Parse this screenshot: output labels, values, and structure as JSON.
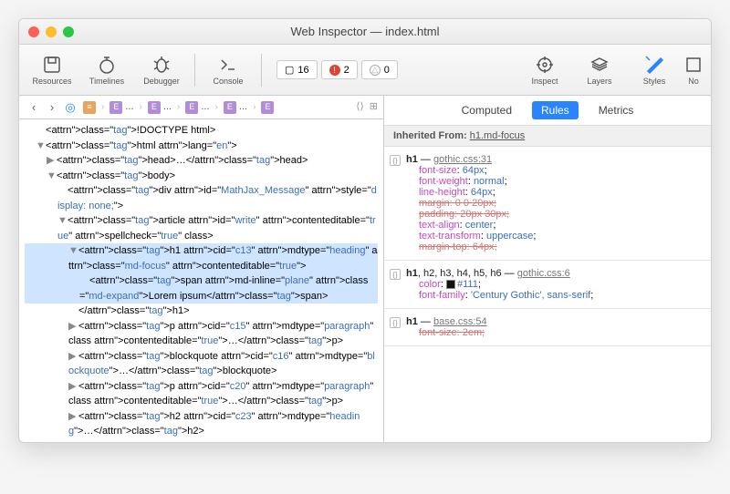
{
  "window": {
    "title": "Web Inspector — index.html"
  },
  "toolbar": {
    "items": [
      {
        "id": "resources",
        "label": "Resources"
      },
      {
        "id": "timelines",
        "label": "Timelines"
      },
      {
        "id": "debugger",
        "label": "Debugger"
      },
      {
        "id": "console",
        "label": "Console"
      },
      {
        "id": "inspect",
        "label": "Inspect"
      },
      {
        "id": "layers",
        "label": "Layers"
      },
      {
        "id": "styles",
        "label": "Styles"
      },
      {
        "id": "node",
        "label": "No"
      }
    ],
    "counters": {
      "resources": "16",
      "errors": "2",
      "warnings": "0"
    }
  },
  "crumbs": {
    "items": [
      "E",
      "...",
      "E",
      "...",
      "E",
      "...",
      "E",
      "...",
      "E"
    ]
  },
  "dom": {
    "lines": [
      {
        "cls": "i1",
        "tri": "",
        "html": "<!DOCTYPE html>"
      },
      {
        "cls": "i1",
        "tri": "▼",
        "html": "<html lang=\"en\">"
      },
      {
        "cls": "i2",
        "tri": "▶",
        "html": "<head>…</head>"
      },
      {
        "cls": "i2",
        "tri": "▼",
        "html": "<body>"
      },
      {
        "cls": "i3",
        "tri": "",
        "html": "<div id=\"MathJax_Message\" style=\"display: none;\">"
      },
      {
        "cls": "i3",
        "tri": "▼",
        "html": "<article id=\"write\" contenteditable=\"true\" spellcheck=\"true\" class>"
      },
      {
        "cls": "i4 hl",
        "tri": "▼",
        "html": "<h1 cid=\"c13\" mdtype=\"heading\" class=\"md-focus\" contenteditable=\"true\">"
      },
      {
        "cls": "i5 hl",
        "tri": "",
        "html": "<span md-inline=\"plane\" class=\"md-expand\">Lorem ipsum</span>"
      },
      {
        "cls": "i4",
        "tri": "",
        "html": "</h1>"
      },
      {
        "cls": "i4",
        "tri": "▶",
        "html": "<p cid=\"c15\" mdtype=\"paragraph\" class contenteditable=\"true\">…</p>"
      },
      {
        "cls": "i4",
        "tri": "▶",
        "html": "<blockquote cid=\"c16\" mdtype=\"blockquote\">…</blockquote>"
      },
      {
        "cls": "i4",
        "tri": "▶",
        "html": "<p cid=\"c20\" mdtype=\"paragraph\" class contenteditable=\"true\">…</p>"
      },
      {
        "cls": "i4",
        "tri": "▶",
        "html": "<h2 cid=\"c23\" mdtype=\"heading\">…</h2>"
      }
    ]
  },
  "styles": {
    "tabs": [
      "Computed",
      "Rules",
      "Metrics"
    ],
    "active_tab": "Rules",
    "inherit_label": "Inherited From:",
    "inherit_selector": "h1.md-focus",
    "rules": [
      {
        "selector_html": "<b>h1</b>",
        "source": "gothic.css:31",
        "decls": [
          {
            "p": "font-size",
            "v": "64px"
          },
          {
            "p": "font-weight",
            "v": "normal"
          },
          {
            "p": "line-height",
            "v": "64px"
          },
          {
            "p": "margin",
            "v": "0 0 20px",
            "strike": true
          },
          {
            "p": "padding",
            "v": "20px 30px",
            "strike": true
          },
          {
            "p": "text-align",
            "v": "center"
          },
          {
            "p": "text-transform",
            "v": "uppercase"
          },
          {
            "p": "margin-top",
            "v": "64px",
            "strike": true
          }
        ]
      },
      {
        "selector_html": "<b>h1</b>, h2, h3, h4, h5, h6",
        "source": "gothic.css:6",
        "decls": [
          {
            "p": "color",
            "v": "#111",
            "swatch": true
          },
          {
            "p": "font-family",
            "v": "'Century Gothic', sans-serif"
          }
        ]
      },
      {
        "selector_html": "<b>h1</b>",
        "source": "base.css:54",
        "decls": [
          {
            "p": "font-size",
            "v": "2em",
            "strike": true
          }
        ]
      }
    ]
  }
}
